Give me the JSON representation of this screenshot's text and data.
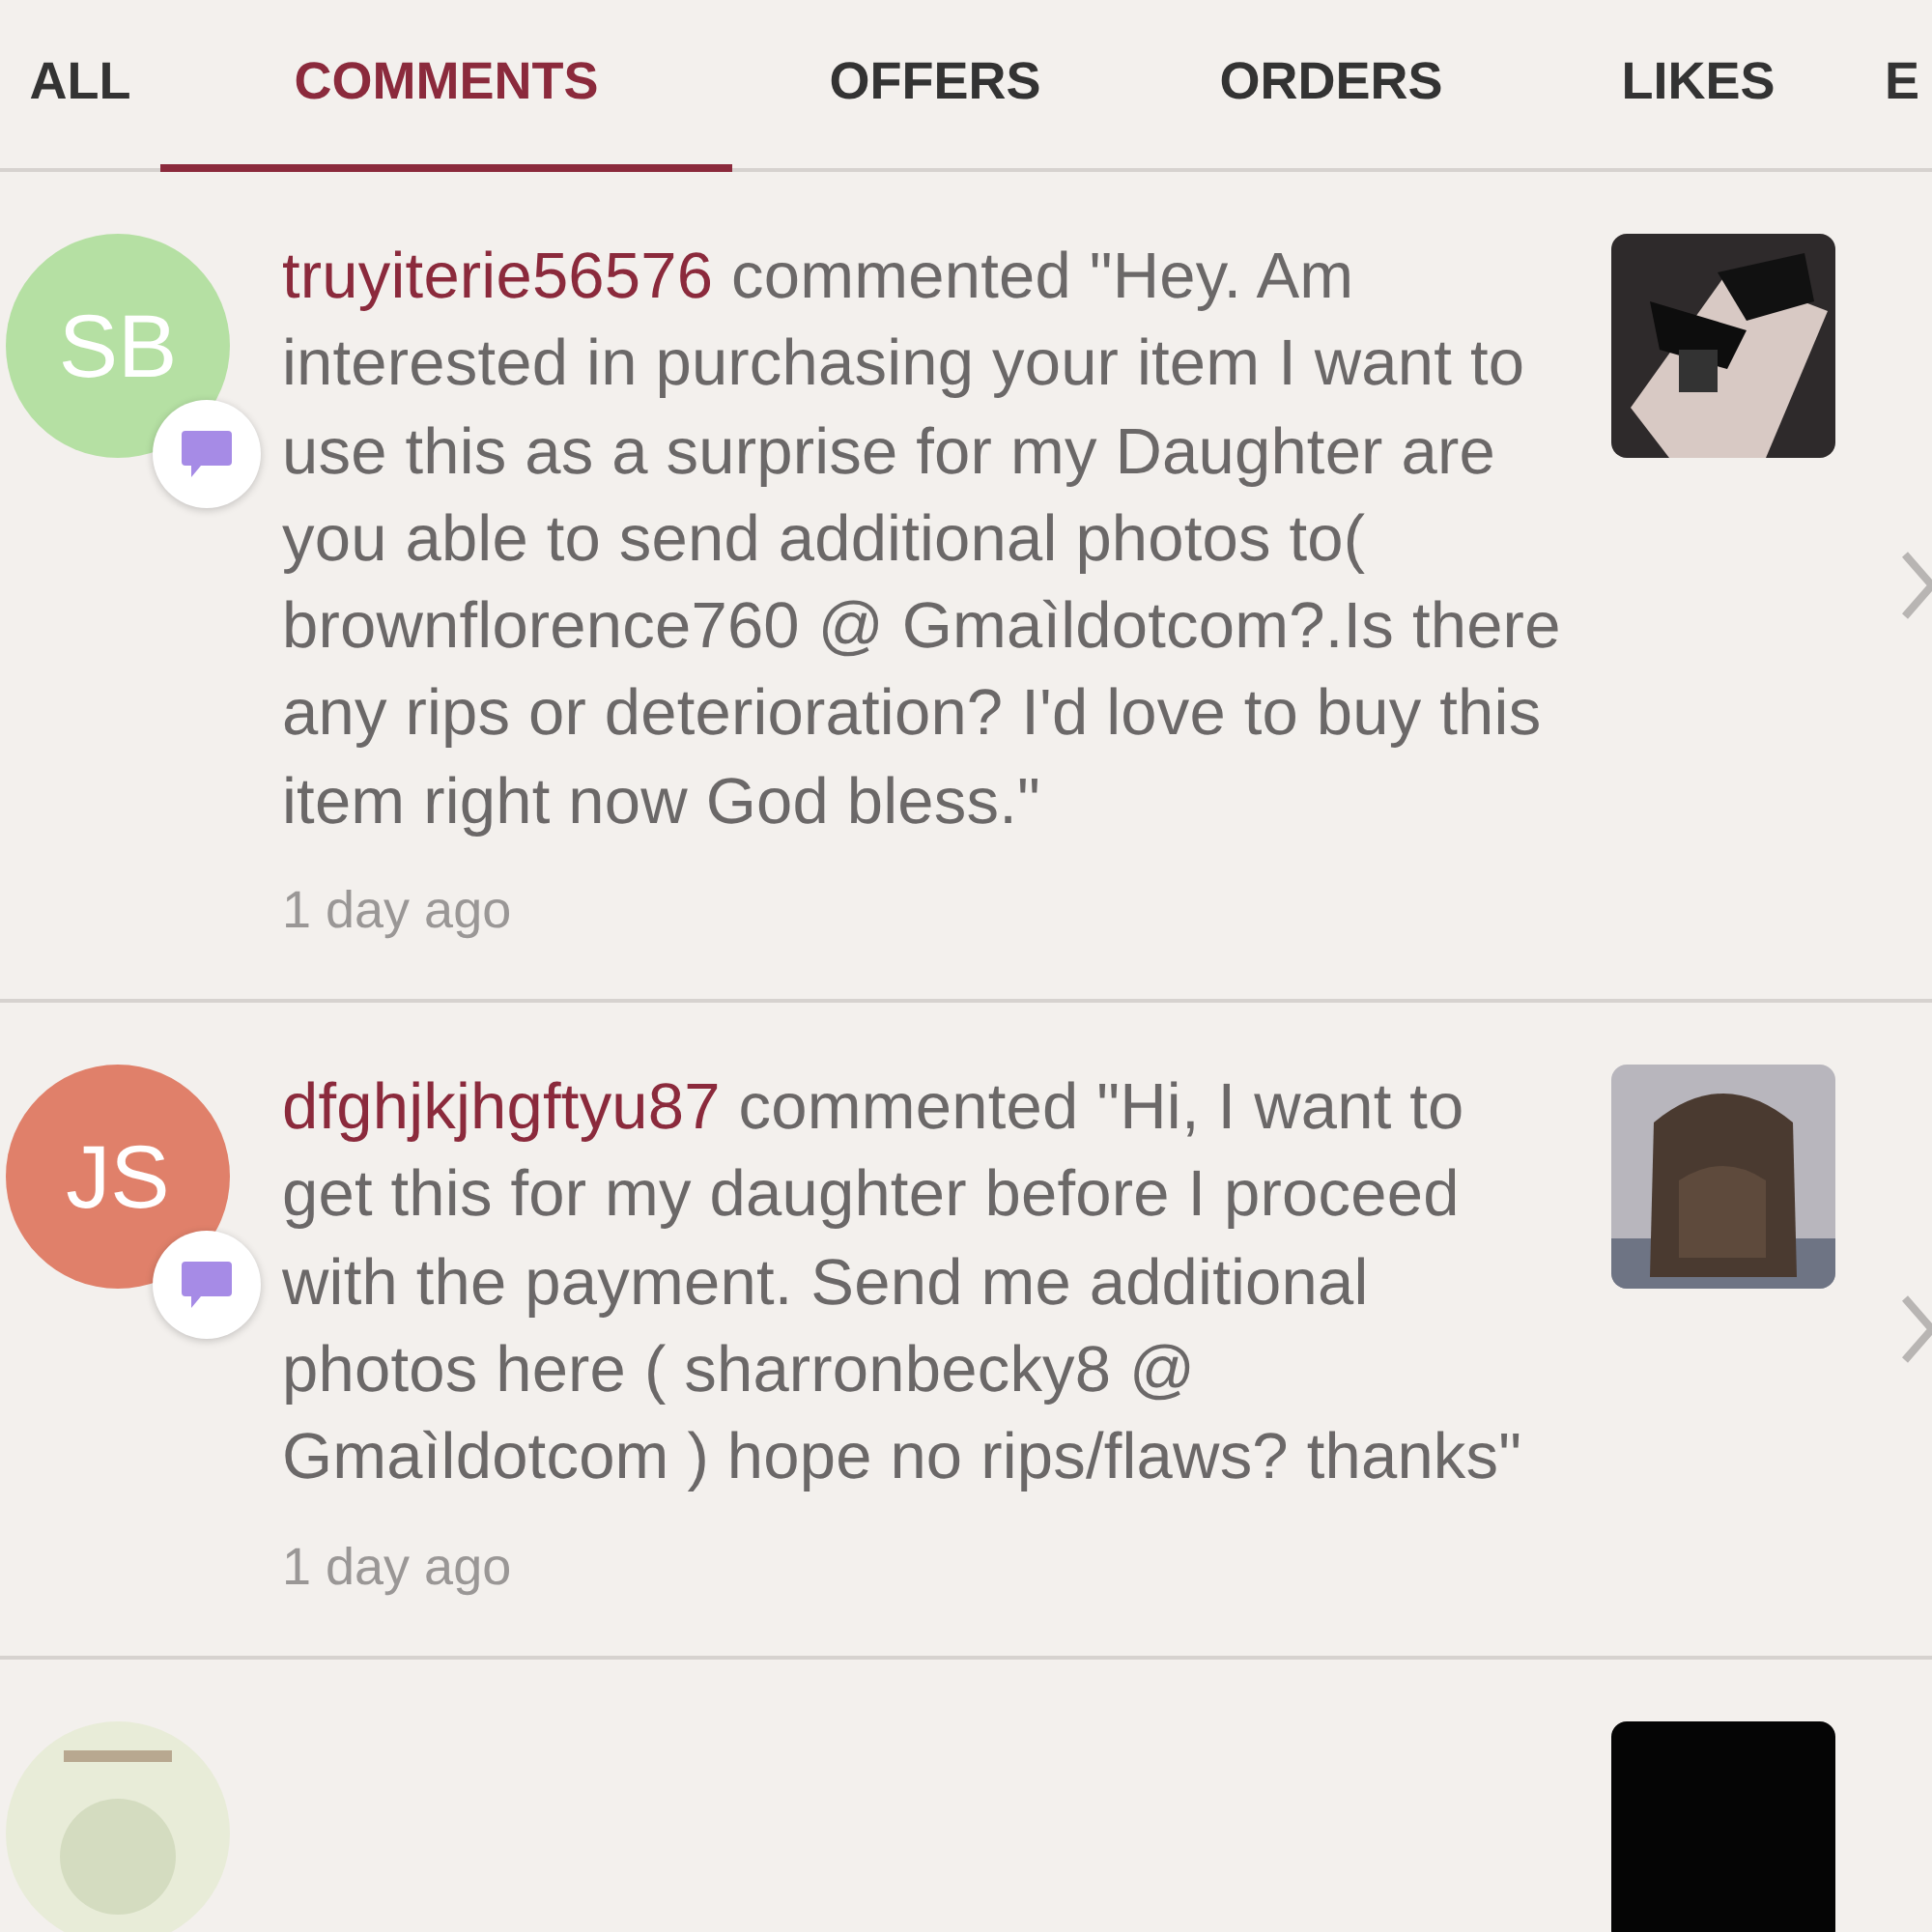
{
  "tabs": [
    {
      "label": "ALL",
      "selected": false
    },
    {
      "label": "COMMENTS",
      "selected": true
    },
    {
      "label": "OFFERS",
      "selected": false
    },
    {
      "label": "ORDERS",
      "selected": false
    },
    {
      "label": "LIKES",
      "selected": false
    },
    {
      "label": "E",
      "selected": false
    }
  ],
  "notifications": [
    {
      "kind": "initials",
      "initials": "SB",
      "color": "#b5e0a3",
      "user": "truyiterie56576",
      "text": "commented \"Hey. Am interested in purchasing your item I want to use this as a surprise for my Daughter are you able to send additional photos to( brownflorence760 @ Gmaìldotcom?.Is there any rips or deterioration? I'd love to buy this item right now God bless.\"",
      "time": "1 day ago"
    },
    {
      "kind": "initials",
      "initials": "JS",
      "color": "#e0806a",
      "user": "dfghjkjhgftyu87",
      "text": "commented \"Hi, I want to get this for my daughter before I proceed with the payment. Send me additional photos here ( sharronbecky8 @ Gmaìldotcom ) hope no rips/flaws? thanks\"",
      "time": "1 day ago"
    },
    {
      "kind": "picture"
    }
  ]
}
